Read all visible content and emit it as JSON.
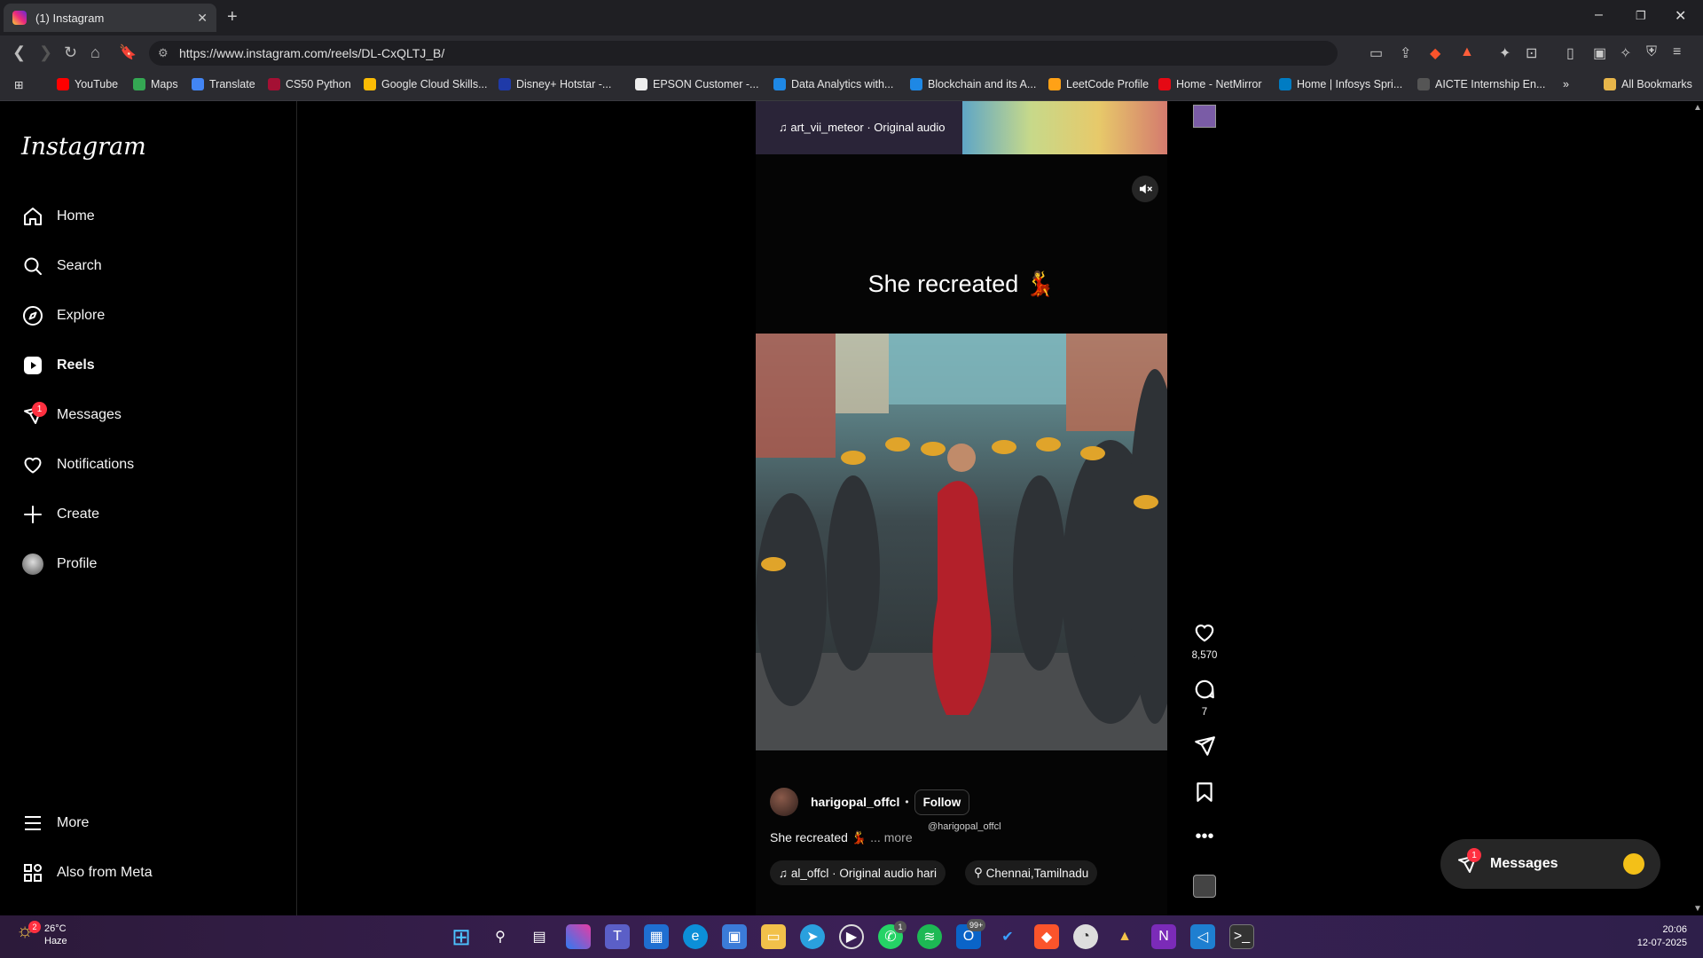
{
  "browser": {
    "tab_title": "(1) Instagram",
    "url": "https://www.instagram.com/reels/DL-CxQLTJ_B/",
    "bookmarks": [
      "YouTube",
      "Maps",
      "Translate",
      "CS50 Python",
      "Google Cloud Skills...",
      "Disney+ Hotstar -...",
      "EPSON Customer -...",
      "Data Analytics with...",
      "Blockchain and its A...",
      "LeetCode Profile",
      "Home - NetMirror",
      "Home | Infosys Spri...",
      "AICTE Internship En..."
    ],
    "all_bookmarks": "All Bookmarks"
  },
  "sidebar": {
    "logo": "Instagram",
    "items": [
      {
        "label": "Home",
        "icon": "home-icon"
      },
      {
        "label": "Search",
        "icon": "search-icon"
      },
      {
        "label": "Explore",
        "icon": "compass-icon"
      },
      {
        "label": "Reels",
        "icon": "reels-icon"
      },
      {
        "label": "Messages",
        "icon": "messenger-icon"
      },
      {
        "label": "Notifications",
        "icon": "heart-icon"
      },
      {
        "label": "Create",
        "icon": "plus-icon"
      },
      {
        "label": "Profile",
        "icon": "profile-avatar"
      }
    ],
    "messages_badge": "1",
    "more": "More",
    "also_from_meta": "Also from Meta"
  },
  "prev_reel": {
    "audio": "art_vii_meteor · Original audio"
  },
  "reel": {
    "title": "She recreated 💃",
    "username": "harigopal_offcl",
    "follow_label": "Follow",
    "caption": "She recreated 💃",
    "more_label": "... more",
    "handle_tag": "@harigopal_offcl",
    "audio": "al_offcl · Original audio  hari",
    "location": "Chennai,Tamilnadu",
    "likes": "8,570",
    "comments": "7"
  },
  "messages_popup": {
    "label": "Messages",
    "badge": "1"
  },
  "taskbar": {
    "weather_temp": "26°C",
    "weather_desc": "Haze",
    "weather_badge": "2",
    "time": "20:06",
    "date": "12-07-2025",
    "whatsapp_badge": "1",
    "outlook_badge": "99+"
  },
  "colors": {
    "background": "#000000",
    "notification_red": "#ff3040",
    "chrome_bg": "#2b2b30"
  }
}
